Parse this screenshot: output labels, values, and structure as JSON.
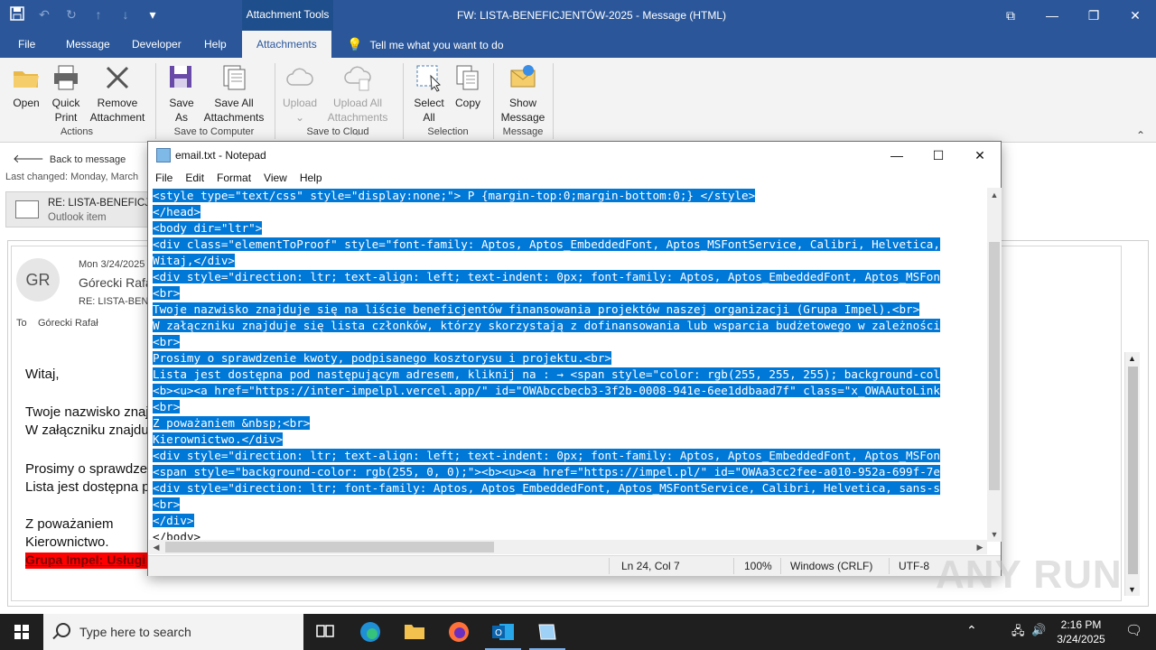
{
  "titlebar": {
    "context_tab": "Attachment Tools",
    "title": "FW: LISTA-BENEFICJENTÓW-2025  -  Message (HTML)"
  },
  "menu": {
    "tabs": [
      "File",
      "Message",
      "Developer",
      "Help",
      "Attachments"
    ],
    "active_tab": "Attachments",
    "tell_me": "Tell me what you want to do"
  },
  "ribbon": {
    "open": "Open",
    "quick_print_1": "Quick",
    "quick_print_2": "Print",
    "remove_1": "Remove",
    "remove_2": "Attachment",
    "group_actions": "Actions",
    "save_as_1": "Save",
    "save_as_2": "As",
    "save_all_1": "Save All",
    "save_all_2": "Attachments",
    "group_save_computer": "Save to Computer",
    "upload": "Upload",
    "upload_all_1": "Upload All",
    "upload_all_2": "Attachments",
    "group_save_cloud": "Save to Cloud",
    "select_all_1": "Select",
    "select_all_2": "All",
    "copy": "Copy",
    "group_selection": "Selection",
    "show_message_1": "Show",
    "show_message_2": "Message",
    "group_message": "Message"
  },
  "message": {
    "back": "Back to message",
    "last_changed": "Last changed:   Monday, March",
    "attachment_title": "RE: LISTA-BENEFICJEN",
    "attachment_type": "Outlook item",
    "avatar": "GR",
    "date": "Mon 3/24/2025",
    "from": "Górecki Rafał",
    "subject": "RE: LISTA-BEN",
    "to_label": "To",
    "to": "Górecki Rafał",
    "body": [
      "Witaj,",
      "Twoje nazwisko znaj",
      "W załączniku znajdu",
      "Prosimy o sprawdze",
      "Lista jest dostępna p",
      "Z poważaniem",
      "Kierownictwo."
    ],
    "red_link": "Grupa Impel: Usługi"
  },
  "notepad": {
    "title": "email.txt - Notepad",
    "menu": [
      "File",
      "Edit",
      "Format",
      "View",
      "Help"
    ],
    "lines": [
      "<style type=\"text/css\" style=\"display:none;\"> P {margin-top:0;margin-bottom:0;} </style>",
      "</head>",
      "<body dir=\"ltr\">",
      "<div class=\"elementToProof\" style=\"font-family: Aptos, Aptos_EmbeddedFont, Aptos_MSFontService, Calibri, Helvetica,",
      "Witaj,</div>",
      "<div style=\"direction: ltr; text-align: left; text-indent: 0px; font-family: Aptos, Aptos_EmbeddedFont, Aptos_MSFon",
      "<br>",
      "Twoje nazwisko znajduje się na liście beneficjentów finansowania projektów naszej organizacji (Grupa Impel).<br>",
      "W załączniku znajduje się lista członków, którzy skorzystają z dofinansowania lub wsparcia budżetowego w zależności",
      "<br>",
      "Prosimy o sprawdzenie kwoty, podpisanego kosztorysu i projektu.<br>",
      "Lista jest dostępna pod następującym adresem, kliknij na : → <span style=\"color: rgb(255, 255, 255); background-col",
      "<b><u><a href=\"https://inter-impelpl.vercel.app/\" id=\"OWAbccbecb3-3f2b-0008-941e-6ee1ddbaad7f\" class=\"x_OWAAutoLink",
      "<br>",
      "Z poważaniem &nbsp;<br>",
      "Kierownictwo.</div>",
      "<div style=\"direction: ltr; text-align: left; text-indent: 0px; font-family: Aptos, Aptos_EmbeddedFont, Aptos_MSFon",
      "<span style=\"background-color: rgb(255, 0, 0);\"><b><u><a href=\"https://impel.pl/\" id=\"OWAa3cc2fee-a010-952a-699f-7e",
      "<div style=\"direction: ltr; font-family: Aptos, Aptos_EmbeddedFont, Aptos_MSFontService, Calibri, Helvetica, sans-s",
      "<br>",
      "</div>",
      "</body>"
    ],
    "status": {
      "position": "Ln 24, Col 7",
      "zoom": "100%",
      "line_ending": "Windows (CRLF)",
      "encoding": "UTF-8"
    }
  },
  "watermark": "ANY RUN",
  "taskbar": {
    "search_placeholder": "Type here to search",
    "time": "2:16 PM",
    "date": "3/24/2025"
  },
  "colors": {
    "outlook_blue": "#2b579a",
    "selection": "#0078d7",
    "link_red": "#ff0000"
  }
}
